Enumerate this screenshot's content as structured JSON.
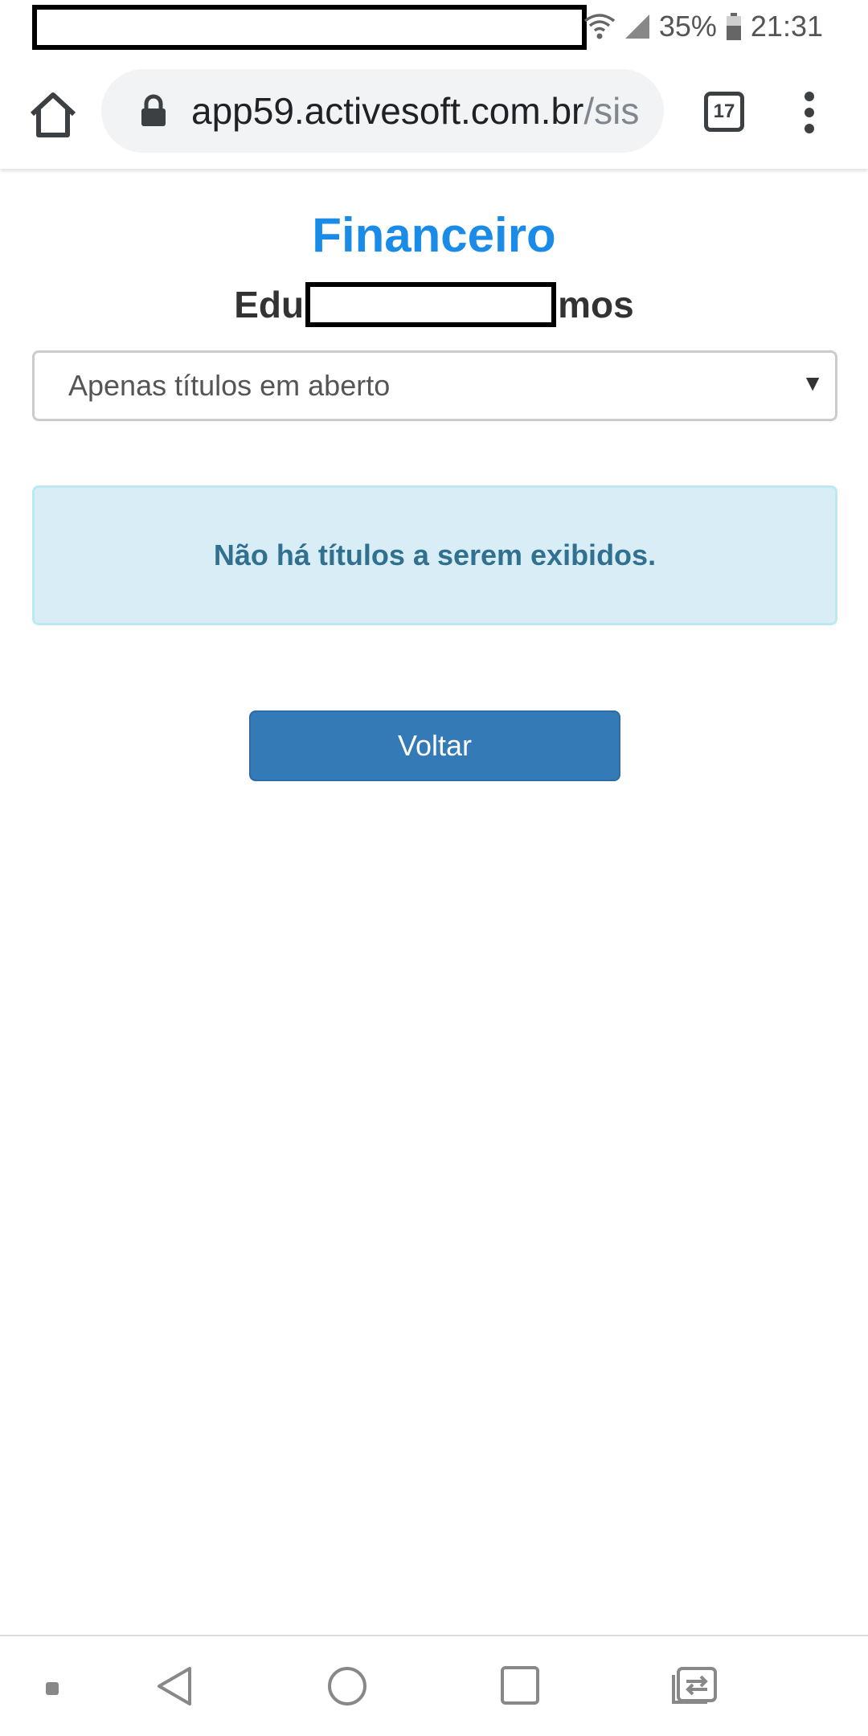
{
  "status_bar": {
    "battery_percent": "35%",
    "time": "21:31",
    "icons": [
      "wifi-icon",
      "signal-icon",
      "battery-icon"
    ]
  },
  "browser": {
    "url_host": "app59.activesoft.com.br",
    "url_path": "/sis",
    "tab_count": "17",
    "icons": [
      "home-icon",
      "lock-icon",
      "tabs-icon",
      "more-vert-icon"
    ]
  },
  "page": {
    "title": "Financeiro",
    "user_name_start": "Edu",
    "user_name_end": "mos",
    "filter": {
      "selected": "Apenas títulos em aberto"
    },
    "alert_message": "Não há títulos a serem exibidos.",
    "back_button_label": "Voltar"
  },
  "nav_bar": {
    "icons": [
      "dot-icon",
      "back-icon",
      "home-circle-icon",
      "recents-icon",
      "switch-app-icon"
    ]
  },
  "colors": {
    "title": "#1a8be6",
    "alert_bg": "#d9edf7",
    "alert_text": "#31708f",
    "button_bg": "#337ab7"
  }
}
